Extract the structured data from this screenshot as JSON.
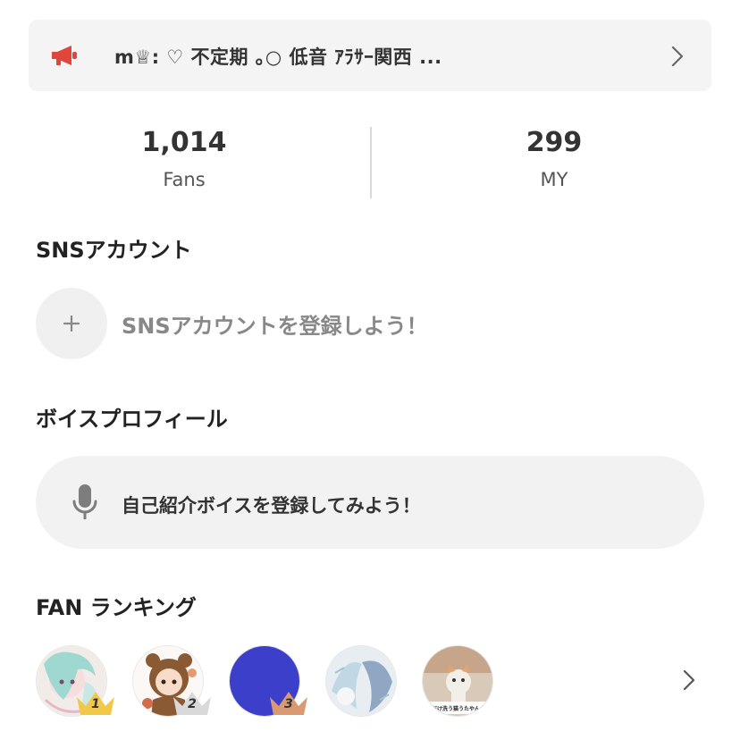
{
  "announcement": {
    "icon": "megaphone-icon",
    "text": "m♕: ♡ 不定期 ｡○ 低音 ｱﾗｻｰ関西 ...",
    "accent_color": "#e0473a"
  },
  "stats": {
    "fans": {
      "value": "1,014",
      "label": "Fans"
    },
    "my": {
      "value": "299",
      "label": "MY"
    }
  },
  "sns": {
    "title": "SNSアカウント",
    "add_icon": "plus-icon",
    "prompt": "SNSアカウントを登録しよう！"
  },
  "voice_profile": {
    "title": "ボイスプロフィール",
    "icon": "microphone-icon",
    "prompt": "自己紹介ボイスを登録してみよう！"
  },
  "fan_ranking": {
    "title": "FAN ランキング",
    "entries": [
      {
        "rank": "1",
        "crown_color": "#f2c84b"
      },
      {
        "rank": "2",
        "crown_color": "#d9d9d9"
      },
      {
        "rank": "3",
        "crown_color": "#d99a72"
      },
      {
        "rank": "",
        "crown_color": ""
      },
      {
        "rank": "",
        "crown_color": ""
      }
    ],
    "avatar5_caption": "「足だけ洗う猫うたやんか！」"
  }
}
